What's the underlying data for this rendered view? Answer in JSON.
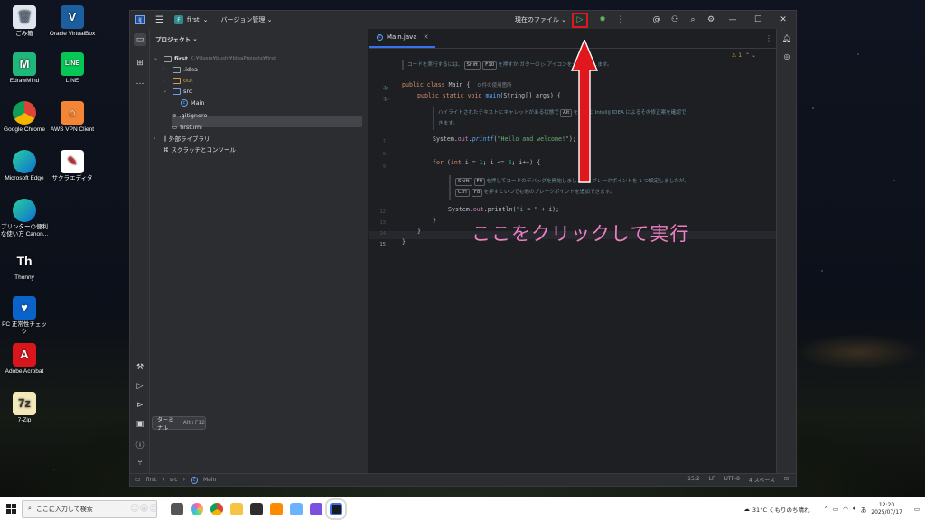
{
  "desktop": {
    "icons": [
      "ごみ箱",
      "Oracle VirtualBox",
      "EdrawMind",
      "LINE",
      "Google Chrome",
      "AWS VPN Client",
      "Microsoft Edge",
      "サクラエディタ",
      "プリンターの便利な使い方 Canon...",
      "Thonny",
      "PC 正常性チェック",
      "Adobe Acrobat",
      "7-Zip"
    ]
  },
  "titlebar": {
    "project_badge": "F",
    "project_name": "first",
    "vcs_menu": "バージョン管理",
    "run_config": "現在のファイル"
  },
  "project_panel": {
    "title": "プロジェクト",
    "root": "first",
    "root_path": "C:¥Users¥bushi¥IdeaProjects¥first",
    "items": [
      ".idea",
      "out",
      "src",
      "Main",
      ".gitignore",
      "first.iml",
      "外部ライブラリ",
      "スクラッチとコンソール"
    ]
  },
  "terminal_tip": {
    "label": "ターミナル",
    "shortcut": "Alt+F12"
  },
  "editor": {
    "tab": "Main.java",
    "warning_count": "1",
    "line_numbers": [
      "2",
      "3",
      "7",
      "8",
      "9",
      "12",
      "13",
      "14",
      "15"
    ],
    "doc1": {
      "pre": "コードを実行するには、",
      "k1": "Shift",
      "k2": "F10",
      "post": "を押すか ガターの ▷ アイコンをクリックします。"
    },
    "class_line": {
      "kw": "public class",
      "name": "Main",
      "brace": "{",
      "hint": "0 件の使用箇所"
    },
    "main_line": {
      "kw": "public static void",
      "fn": "main",
      "rest": "(String[] args) {"
    },
    "doc2": {
      "line1_pre": "ハイライトされたテキストにキャレットがある状態で",
      "k": "Alt",
      "line1_post": "を押すと IntelliJ IDEA によるその修正案を確認で",
      "line2": "きます。"
    },
    "printf_line": {
      "obj": "System.",
      "fld": "out",
      "dot": ".",
      "fn": "printf",
      "open": "(",
      "str": "\"Hello and welcome!\"",
      "close": ");"
    },
    "for_line": {
      "kw": "for",
      "open": " (",
      "kw2": "int",
      "var": " i = ",
      "n1": "1",
      "mid": "; i <= ",
      "n2": "5",
      "end": "; i++) {"
    },
    "doc3": {
      "k1": "Shift",
      "k2": "F9",
      "line1": "を押してコードのデバッグを開始しましょう。ブレークポイントを 1 つ設定しましたが、",
      "k3": "Ctrl",
      "k4": "F8",
      "line2": "を押すといつでも他のブレークポイントを追加できます。"
    },
    "println_line": {
      "obj": "System.",
      "fld": "out",
      "rest": ".println(",
      "str": "\"i = \"",
      "tail": " + i);"
    },
    "close_inner": "}",
    "close_outer": "}",
    "last": "}"
  },
  "status": {
    "crumbs": [
      "first",
      "src",
      "Main"
    ],
    "position": "15:2",
    "line_sep": "LF",
    "encoding": "UTF-8",
    "indent": "4 スペース"
  },
  "annotation": {
    "text": "ここをクリックして実行",
    "color": "#ef7fc4",
    "arrow_color": "#e0181e"
  },
  "taskbar": {
    "search_placeholder": "ここに入力して検索",
    "weather": "31°C くもりのち晴れ",
    "time": "12:20",
    "date": "2025/07/17"
  }
}
